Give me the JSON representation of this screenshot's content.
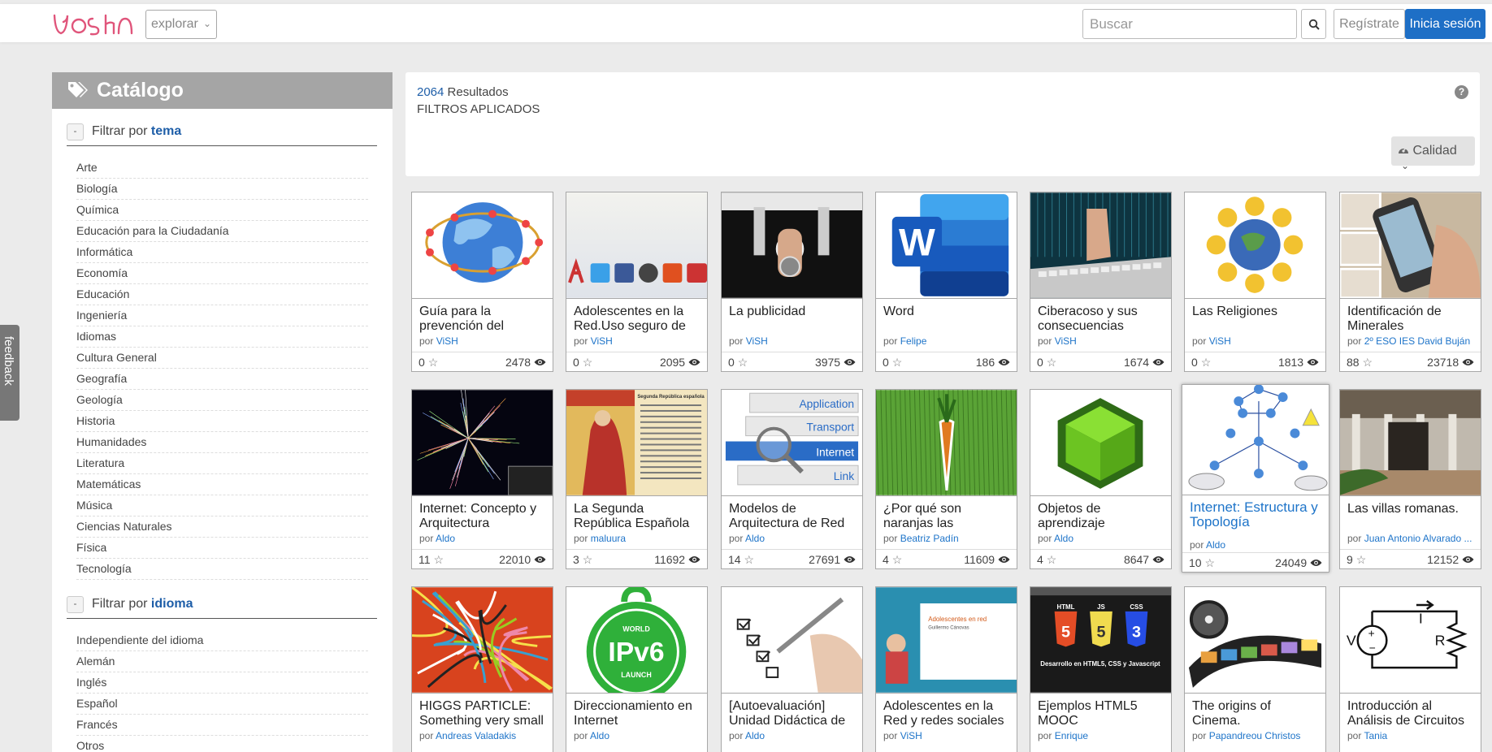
{
  "header": {
    "logo": "ViSH",
    "explore_label": "explorar",
    "search_placeholder": "Buscar",
    "register_label": "Regístrate",
    "login_label": "Inicia sesión",
    "accent": "#1e6fc6",
    "logo_color": "#e0557b"
  },
  "feedback_label": "feedback",
  "sidebar": {
    "title": "Catálogo",
    "filter_prefix": "Filtrar por",
    "topic_filter": {
      "toggle": "-",
      "key": "tema",
      "items": [
        "Arte",
        "Biología",
        "Química",
        "Educación para la Ciudadanía",
        "Informática",
        "Economía",
        "Educación",
        "Ingeniería",
        "Idiomas",
        "Cultura General",
        "Geografía",
        "Geología",
        "Historia",
        "Humanidades",
        "Literatura",
        "Matemáticas",
        "Música",
        "Ciencias Naturales",
        "Física",
        "Tecnología"
      ]
    },
    "language_filter": {
      "toggle": "-",
      "key": "idioma",
      "items": [
        "Independiente del idioma",
        "Alemán",
        "Inglés",
        "Español",
        "Francés",
        "Otros"
      ]
    }
  },
  "results": {
    "count": "2064",
    "count_label": "Resultados",
    "applied": "FILTROS APLICADOS",
    "help": "?",
    "sort_label": "Calidad"
  },
  "by_label": "por",
  "cards": [
    {
      "title": "Guía para la prevención del",
      "author": "ViSH",
      "likes": "0",
      "views": "2478",
      "thumb": "globe"
    },
    {
      "title": "Adolescentes en la Red.Uso seguro de",
      "author": "ViSH",
      "likes": "0",
      "views": "2095",
      "thumb": "social"
    },
    {
      "title": "La publicidad",
      "author": "ViSH",
      "likes": "0",
      "views": "3975",
      "thumb": "watches"
    },
    {
      "title": "Word",
      "author": "Felipe",
      "likes": "0",
      "views": "186",
      "thumb": "word"
    },
    {
      "title": "Ciberacoso y sus consecuencias",
      "author": "ViSH",
      "likes": "0",
      "views": "1674",
      "thumb": "keyboard"
    },
    {
      "title": "Las Religiones",
      "author": "ViSH",
      "likes": "0",
      "views": "1813",
      "thumb": "religions"
    },
    {
      "title": "Identificación de Minerales",
      "author": "2º ESO IES David Buján",
      "likes": "88",
      "views": "23718",
      "thumb": "phone"
    },
    {
      "title": "Internet: Concepto y Arquitectura",
      "author": "Aldo",
      "likes": "11",
      "views": "22010",
      "thumb": "network"
    },
    {
      "title": "La Segunda República Española",
      "author": "maluura",
      "likes": "3",
      "views": "11692",
      "thumb": "republic"
    },
    {
      "title": "Modelos de Arquitectura de Red",
      "author": "Aldo",
      "likes": "14",
      "views": "27691",
      "thumb": "layers"
    },
    {
      "title": "¿Por qué son naranjas las",
      "author": "Beatriz Padín",
      "likes": "4",
      "views": "11609",
      "thumb": "carrot"
    },
    {
      "title": "Objetos de aprendizaje",
      "author": "Aldo",
      "likes": "4",
      "views": "8647",
      "thumb": "cube"
    },
    {
      "title": "Internet: Estructura y Topología",
      "author": "Aldo",
      "likes": "10",
      "views": "24049",
      "thumb": "topology",
      "highlight": true
    },
    {
      "title": "Las villas romanas.",
      "author": "Juan Antonio Alvarado ...",
      "likes": "9",
      "views": "12152",
      "thumb": "villa"
    },
    {
      "title": "HIGGS PARTICLE: Something very small",
      "author": "Andreas Valadakis",
      "likes": "",
      "views": "",
      "thumb": "higgs"
    },
    {
      "title": "Direccionamiento en Internet",
      "author": "Aldo",
      "likes": "",
      "views": "",
      "thumb": "ipv6"
    },
    {
      "title": "[Autoevaluación] Unidad Didáctica de",
      "author": "Aldo",
      "likes": "",
      "views": "",
      "thumb": "checklist"
    },
    {
      "title": "Adolescentes en la Red y redes sociales",
      "author": "ViSH",
      "likes": "",
      "views": "",
      "thumb": "slide"
    },
    {
      "title": "Ejemplos HTML5 MOOC",
      "author": "Enrique",
      "likes": "",
      "views": "",
      "thumb": "html5"
    },
    {
      "title": "The origins of Cinema.",
      "author": "Papandreou Christos",
      "likes": "",
      "views": "",
      "thumb": "film"
    },
    {
      "title": "Introducción al Análisis de Circuitos",
      "author": "Tania",
      "likes": "",
      "views": "",
      "thumb": "circuit"
    }
  ],
  "thumb_text": {
    "word_letter": "W",
    "layers": [
      "Application",
      "Transport",
      "Internet",
      "Link"
    ],
    "ipv6": [
      "WORLD",
      "IPv6",
      "LAUNCH"
    ],
    "html5": [
      "HTML",
      "JS",
      "CSS",
      "5",
      "5",
      "3",
      "Desarrollo en HTML5, CSS y Javascript"
    ],
    "slide": [
      "Adolescentes en red",
      "Guillermo Cánovas"
    ],
    "circuit": [
      "V",
      "I",
      "R",
      "+",
      "−"
    ],
    "republic": "Segunda República española"
  }
}
